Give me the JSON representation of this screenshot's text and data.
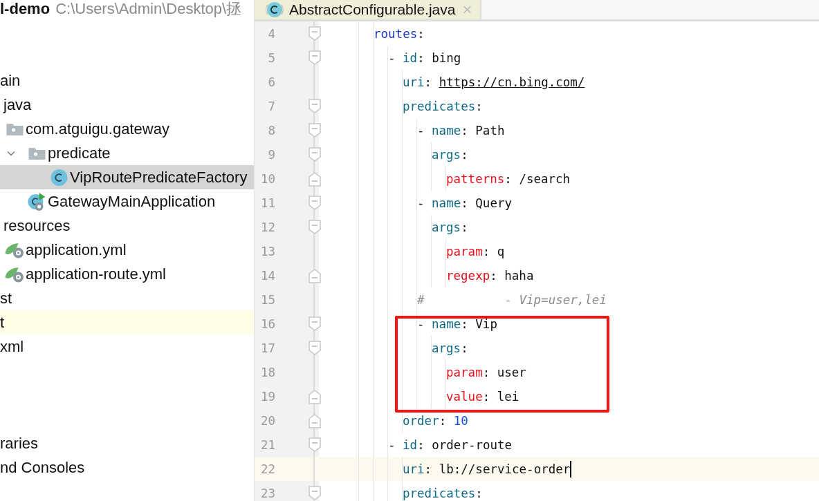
{
  "project": {
    "name": "l-demo",
    "path": "C:\\Users\\Admin\\Desktop\\拯"
  },
  "tree": [
    {
      "label": "ain",
      "kind": "plain",
      "selected": false,
      "highlighted": false,
      "children": [
        {
          "label": "java",
          "kind": "plain",
          "selected": false,
          "highlighted": false,
          "children": [
            {
              "label": "com.atguigu.gateway",
              "kind": "folder",
              "selected": false,
              "highlighted": false,
              "children": [
                {
                  "label": "predicate",
                  "kind": "folder",
                  "expanded": true,
                  "selected": false,
                  "highlighted": false,
                  "children": [
                    {
                      "label": "VipRoutePredicateFactory",
                      "kind": "class",
                      "selected": true,
                      "highlighted": false
                    }
                  ]
                },
                {
                  "label": "GatewayMainApplication",
                  "kind": "runnable",
                  "selected": false,
                  "highlighted": false
                }
              ]
            }
          ]
        },
        {
          "label": "resources",
          "kind": "plain",
          "selected": false,
          "highlighted": false,
          "children": [
            {
              "label": "application.yml",
              "kind": "config",
              "selected": false,
              "highlighted": false
            },
            {
              "label": "application-route.yml",
              "kind": "config",
              "selected": false,
              "highlighted": false
            }
          ]
        }
      ]
    },
    {
      "label": "st",
      "kind": "plain",
      "selected": false,
      "highlighted": false
    },
    {
      "label": "t",
      "kind": "plain",
      "selected": false,
      "highlighted": true
    },
    {
      "label": "xml",
      "kind": "plain",
      "selected": false,
      "highlighted": false
    },
    {
      "kind": "blank"
    },
    {
      "kind": "blank"
    },
    {
      "kind": "blank"
    },
    {
      "label": "raries",
      "kind": "plain",
      "selected": false,
      "highlighted": false
    },
    {
      "label": "nd Consoles",
      "kind": "plain",
      "selected": false,
      "highlighted": false
    }
  ],
  "tabs": [
    {
      "label": "AbstractConfigurable.java",
      "kind": "class",
      "selected": true,
      "close": "×"
    }
  ],
  "editor": {
    "lines": [
      {
        "number": "4",
        "kind": "fold-start",
        "boxed": false,
        "current": false,
        "tokens": [
          {
            "kind": "root-key",
            "text": "routes"
          },
          {
            "kind": "punct",
            "text": ":"
          }
        ],
        "children": [
          {
            "number": "5",
            "kind": "fold-start",
            "boxed": false,
            "current": false,
            "tokens": [
              {
                "kind": "punct",
                "text": "- "
              },
              {
                "kind": "key",
                "text": "id"
              },
              {
                "kind": "punct",
                "text": ": "
              },
              {
                "kind": "value",
                "text": "bing"
              }
            ],
            "children": [
              {
                "number": "6",
                "kind": "plain",
                "boxed": false,
                "current": false,
                "tokens": [
                  {
                    "kind": "key",
                    "text": "uri"
                  },
                  {
                    "kind": "punct",
                    "text": ": "
                  },
                  {
                    "kind": "link",
                    "text": "https://cn.bing.com/"
                  }
                ]
              },
              {
                "number": "7",
                "kind": "fold-start",
                "boxed": false,
                "current": false,
                "tokens": [
                  {
                    "kind": "key",
                    "text": "predicates"
                  },
                  {
                    "kind": "punct",
                    "text": ":"
                  }
                ],
                "children": [
                  {
                    "number": "8",
                    "kind": "fold-start",
                    "boxed": false,
                    "current": false,
                    "tokens": [
                      {
                        "kind": "punct",
                        "text": "- "
                      },
                      {
                        "kind": "key",
                        "text": "name"
                      },
                      {
                        "kind": "punct",
                        "text": ": "
                      },
                      {
                        "kind": "value",
                        "text": "Path"
                      }
                    ],
                    "children": [
                      {
                        "number": "9",
                        "kind": "fold-start",
                        "boxed": false,
                        "current": false,
                        "tokens": [
                          {
                            "kind": "key",
                            "text": "args"
                          },
                          {
                            "kind": "punct",
                            "text": ":"
                          }
                        ],
                        "children": [
                          {
                            "number": "10",
                            "kind": "fold-end",
                            "boxed": false,
                            "current": false,
                            "tokens": [
                              {
                                "kind": "arg-key",
                                "text": "patterns"
                              },
                              {
                                "kind": "punct",
                                "text": ": "
                              },
                              {
                                "kind": "value",
                                "text": "/search"
                              }
                            ]
                          }
                        ]
                      }
                    ]
                  },
                  {
                    "number": "11",
                    "kind": "fold-start",
                    "boxed": false,
                    "current": false,
                    "tokens": [
                      {
                        "kind": "punct",
                        "text": "- "
                      },
                      {
                        "kind": "key",
                        "text": "name"
                      },
                      {
                        "kind": "punct",
                        "text": ": "
                      },
                      {
                        "kind": "value",
                        "text": "Query"
                      }
                    ],
                    "children": [
                      {
                        "number": "12",
                        "kind": "fold-start",
                        "boxed": false,
                        "current": false,
                        "tokens": [
                          {
                            "kind": "key",
                            "text": "args"
                          },
                          {
                            "kind": "punct",
                            "text": ":"
                          }
                        ],
                        "children": [
                          {
                            "number": "13",
                            "kind": "plain",
                            "boxed": false,
                            "current": false,
                            "tokens": [
                              {
                                "kind": "arg-key",
                                "text": "param"
                              },
                              {
                                "kind": "punct",
                                "text": ": "
                              },
                              {
                                "kind": "value",
                                "text": "q"
                              }
                            ]
                          },
                          {
                            "number": "14",
                            "kind": "fold-end",
                            "boxed": false,
                            "current": false,
                            "tokens": [
                              {
                                "kind": "arg-key",
                                "text": "regexp"
                              },
                              {
                                "kind": "punct",
                                "text": ": "
                              },
                              {
                                "kind": "value",
                                "text": "haha"
                              }
                            ]
                          }
                        ]
                      }
                    ]
                  },
                  {
                    "number": "15",
                    "kind": "plain",
                    "boxed": false,
                    "current": false,
                    "tokens": [
                      {
                        "kind": "comment",
                        "text": "#           - Vip=user,lei"
                      }
                    ]
                  },
                  {
                    "number": "16",
                    "kind": "fold-start",
                    "boxed": true,
                    "current": false,
                    "tokens": [
                      {
                        "kind": "punct",
                        "text": "- "
                      },
                      {
                        "kind": "key",
                        "text": "name"
                      },
                      {
                        "kind": "punct",
                        "text": ": "
                      },
                      {
                        "kind": "value",
                        "text": "Vip"
                      }
                    ],
                    "children": [
                      {
                        "number": "17",
                        "kind": "fold-start",
                        "boxed": true,
                        "current": false,
                        "tokens": [
                          {
                            "kind": "key",
                            "text": "args"
                          },
                          {
                            "kind": "punct",
                            "text": ":"
                          }
                        ],
                        "children": [
                          {
                            "number": "18",
                            "kind": "plain",
                            "boxed": true,
                            "current": false,
                            "tokens": [
                              {
                                "kind": "arg-key",
                                "text": "param"
                              },
                              {
                                "kind": "punct",
                                "text": ": "
                              },
                              {
                                "kind": "value",
                                "text": "user"
                              }
                            ]
                          },
                          {
                            "number": "19",
                            "kind": "fold-end",
                            "boxed": true,
                            "current": false,
                            "tokens": [
                              {
                                "kind": "arg-key",
                                "text": "value"
                              },
                              {
                                "kind": "punct",
                                "text": ": "
                              },
                              {
                                "kind": "value",
                                "text": "lei"
                              }
                            ]
                          }
                        ]
                      }
                    ]
                  }
                ]
              },
              {
                "number": "20",
                "kind": "fold-end",
                "boxed": false,
                "current": false,
                "tokens": [
                  {
                    "kind": "key",
                    "text": "order"
                  },
                  {
                    "kind": "punct",
                    "text": ": "
                  },
                  {
                    "kind": "number",
                    "text": "10"
                  }
                ]
              }
            ]
          },
          {
            "number": "21",
            "kind": "fold-start",
            "boxed": false,
            "current": false,
            "tokens": [
              {
                "kind": "punct",
                "text": "- "
              },
              {
                "kind": "key",
                "text": "id"
              },
              {
                "kind": "punct",
                "text": ": "
              },
              {
                "kind": "value",
                "text": "order-route"
              }
            ],
            "children": [
              {
                "number": "22",
                "kind": "plain",
                "boxed": false,
                "current": true,
                "tokens": [
                  {
                    "kind": "key",
                    "text": "uri"
                  },
                  {
                    "kind": "punct",
                    "text": ": "
                  },
                  {
                    "kind": "value",
                    "text": "lb://service-order"
                  }
                ]
              },
              {
                "number": "23",
                "kind": "fold-start",
                "boxed": false,
                "current": false,
                "tokens": [
                  {
                    "kind": "key",
                    "text": "predicates"
                  },
                  {
                    "kind": "punct",
                    "text": ":"
                  }
                ]
              }
            ]
          }
        ]
      }
    ]
  }
}
